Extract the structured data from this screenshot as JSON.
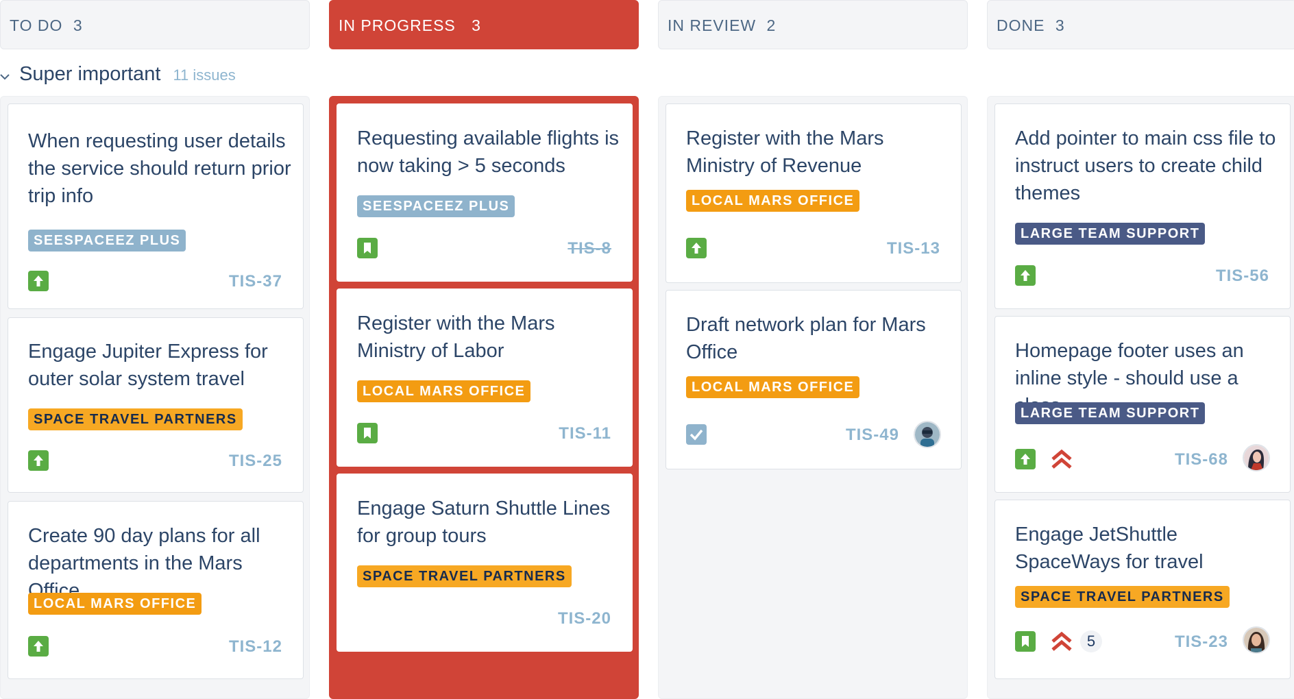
{
  "columns": [
    {
      "title": "TO DO",
      "count": "3"
    },
    {
      "title": "IN PROGRESS",
      "count": "3"
    },
    {
      "title": "IN REVIEW",
      "count": "2"
    },
    {
      "title": "DONE",
      "count": "3"
    }
  ],
  "swimlane": {
    "title": "Super important",
    "issues": "11 issues"
  },
  "colors": {
    "active_column": "#d04437",
    "story_green": "#5aac44",
    "priority_red": "#d04437"
  },
  "cards": {
    "todo": [
      {
        "title": "When requesting user details the service should return prior trip info",
        "tag": "SEESPACEEZ PLUS",
        "key": "TIS-37",
        "type": "improvement-icon"
      },
      {
        "title": "Engage Jupiter Express for outer solar system travel",
        "tag": "SPACE TRAVEL PARTNERS",
        "key": "TIS-25",
        "type": "improvement-icon"
      },
      {
        "title": "Create 90 day plans for all departments in the Mars Office",
        "tag": "LOCAL MARS OFFICE",
        "key": "TIS-12",
        "type": "improvement-icon"
      }
    ],
    "inprogress": [
      {
        "title": "Requesting available flights is now taking > 5 seconds",
        "tag": "SEESPACEEZ PLUS",
        "key": "TIS-8",
        "type": "story-icon"
      },
      {
        "title": "Register with the Mars Ministry of Labor",
        "tag": "LOCAL MARS OFFICE",
        "key": "TIS-11",
        "type": "story-icon"
      },
      {
        "title": "Engage Saturn Shuttle Lines for group tours",
        "tag": "SPACE TRAVEL PARTNERS",
        "key": "TIS-20"
      }
    ],
    "inreview": [
      {
        "title": "Register with the Mars Ministry of Revenue",
        "tag": "LOCAL MARS OFFICE",
        "key": "TIS-13",
        "type": "improvement-icon"
      },
      {
        "title": "Draft network plan for Mars Office",
        "tag": "LOCAL MARS OFFICE",
        "key": "TIS-49",
        "type": "task-icon"
      }
    ],
    "done": [
      {
        "title": "Add pointer to main css file to instruct users to create child themes",
        "tag": "LARGE TEAM SUPPORT",
        "key": "TIS-56",
        "type": "improvement-icon"
      },
      {
        "title": "Homepage footer uses an inline style - should use a class",
        "tag": "LARGE TEAM SUPPORT",
        "key": "TIS-68",
        "type": "improvement-icon",
        "priority": "highest-priority-icon"
      },
      {
        "title": "Engage JetShuttle SpaceWays for travel",
        "tag": "SPACE TRAVEL PARTNERS",
        "key": "TIS-23",
        "type": "story-icon",
        "priority": "highest-priority-icon",
        "count": "5"
      }
    ]
  }
}
